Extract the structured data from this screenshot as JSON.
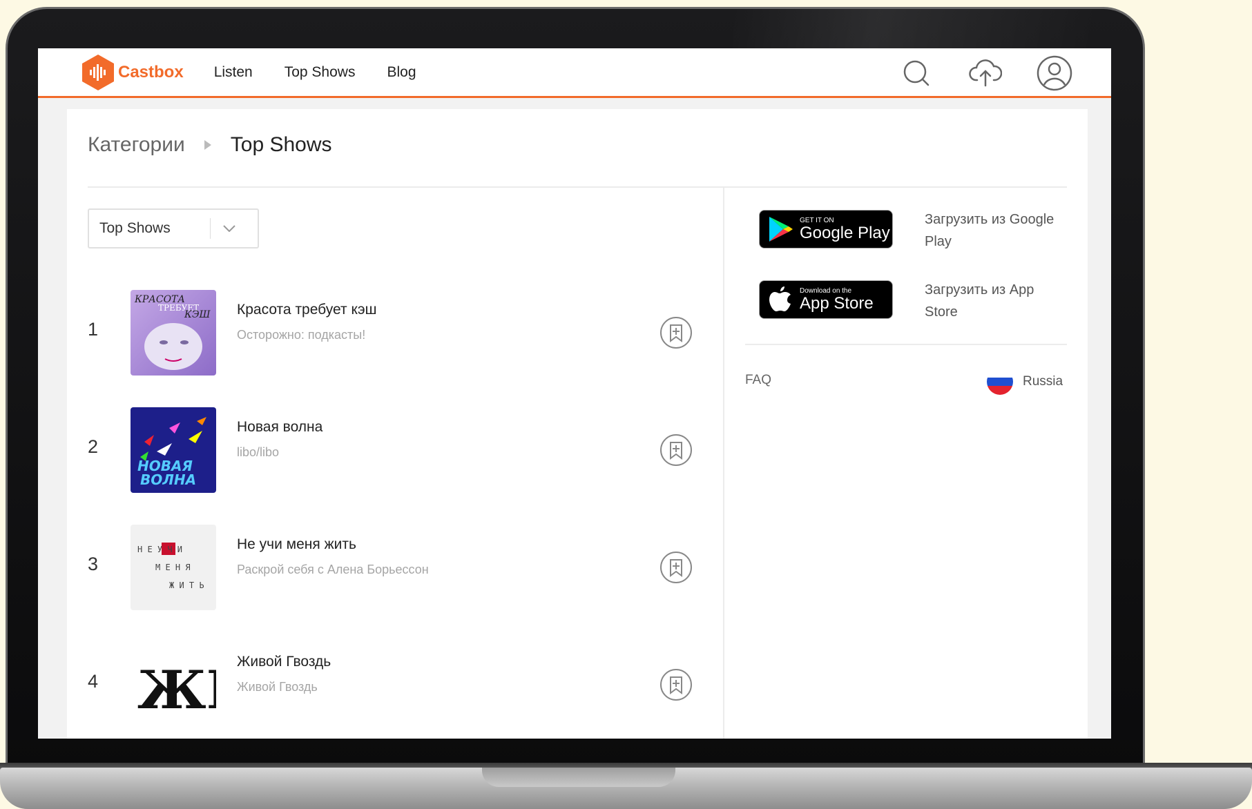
{
  "header": {
    "logo_text": "Castbox",
    "nav": [
      "Listen",
      "Top Shows",
      "Blog"
    ],
    "icons": [
      "search-icon",
      "upload-icon",
      "account-icon"
    ]
  },
  "breadcrumb": {
    "parent": "Категории",
    "current": "Top Shows"
  },
  "filter": {
    "selected": "Top Shows"
  },
  "shows": [
    {
      "rank": "1",
      "title": "Красота требует кэш",
      "author": "Осторожно: подкасты!",
      "cover_text": [
        "КРАСОТА",
        "ТРЕБУЕТ",
        "КЭШ"
      ]
    },
    {
      "rank": "2",
      "title": "Новая волна",
      "author": "libo/libo",
      "cover_text": [
        "НОВАЯ",
        "ВОЛНА"
      ]
    },
    {
      "rank": "3",
      "title": "Не учи меня жить",
      "author": "Раскрой себя с Алена Борьессон",
      "cover_text": [
        "Н Е У Ч И",
        "М Е Н Я",
        "Ж И Т Ь"
      ]
    },
    {
      "rank": "4",
      "title": "Живой Гвоздь",
      "author": "Живой Гвоздь",
      "cover_text": [
        "ЖГ"
      ]
    }
  ],
  "stores": {
    "google": {
      "small": "GET IT ON",
      "big": "Google Play",
      "caption": "Загрузить из Google Play"
    },
    "apple": {
      "small": "Download on the",
      "big": "App Store",
      "caption": "Загрузить из App Store"
    }
  },
  "footer": {
    "faq": "FAQ",
    "region": "Russia"
  },
  "colors": {
    "brand": "#f26b2a",
    "background": "#fdf9e4"
  }
}
